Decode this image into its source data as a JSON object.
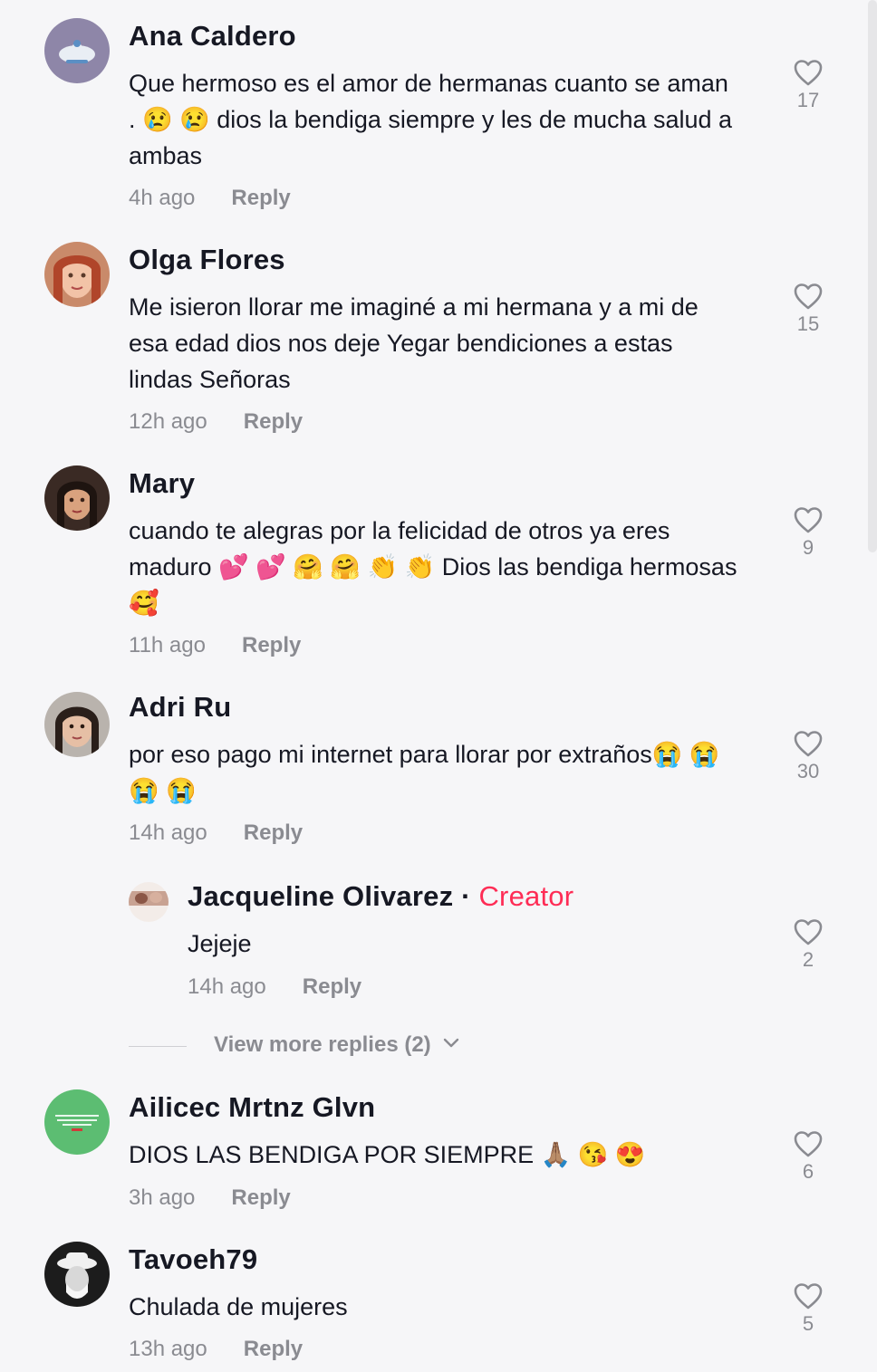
{
  "comments": [
    {
      "username": "Ana Caldero",
      "text_lines": [
        "Que hermoso es el amor de hermanas cuanto se aman",
        ". 😢 😢  dios la bendiga siempre y les de mucha salud a",
        "ambas"
      ],
      "time": "4h ago",
      "reply": "Reply",
      "likes": "17"
    },
    {
      "username": "Olga Flores",
      "text_lines": [
        "Me isieron llorar me imaginé a mi hermana y a mi de",
        "esa edad dios nos deje Yegar bendiciones a estas",
        "lindas Señoras"
      ],
      "time": "12h ago",
      "reply": "Reply",
      "likes": "15"
    },
    {
      "username": "Mary",
      "text_lines": [
        "cuando te alegras por la felicidad de otros ya eres",
        "maduro 💕 💕 🤗 🤗 👏 👏  Dios las bendiga hermosas",
        "🥰"
      ],
      "time": "11h ago",
      "reply": "Reply",
      "likes": "9"
    },
    {
      "username": "Adri Ru",
      "text_lines": [
        "por eso pago mi internet para llorar por extraños😭 😭",
        "😭 😭"
      ],
      "time": "14h ago",
      "reply": "Reply",
      "likes": "30"
    },
    {
      "username": "Jacqueline Olivarez",
      "creator_sep": "·",
      "creator_label": "Creator",
      "text_lines": [
        "Jejeje"
      ],
      "time": "14h ago",
      "reply": "Reply",
      "likes": "2"
    },
    {
      "username": "Ailicec Mrtnz Glvn",
      "text_lines": [
        "DIOS LAS BENDIGA POR SIEMPRE 🙏🏽 😘 😍"
      ],
      "time": "3h ago",
      "reply": "Reply",
      "likes": "6"
    },
    {
      "username": "Tavoeh79",
      "text_lines": [
        "Chulada de mujeres"
      ],
      "time": "13h ago",
      "reply": "Reply",
      "likes": "5"
    }
  ],
  "view_more_replies": "View more replies (2)",
  "icons": {
    "like": "heart-outline-icon",
    "expand": "chevron-down-icon"
  },
  "colors": {
    "creator": "#fe2c55",
    "secondary_text": "#8a8b91",
    "primary_text": "#161823"
  }
}
